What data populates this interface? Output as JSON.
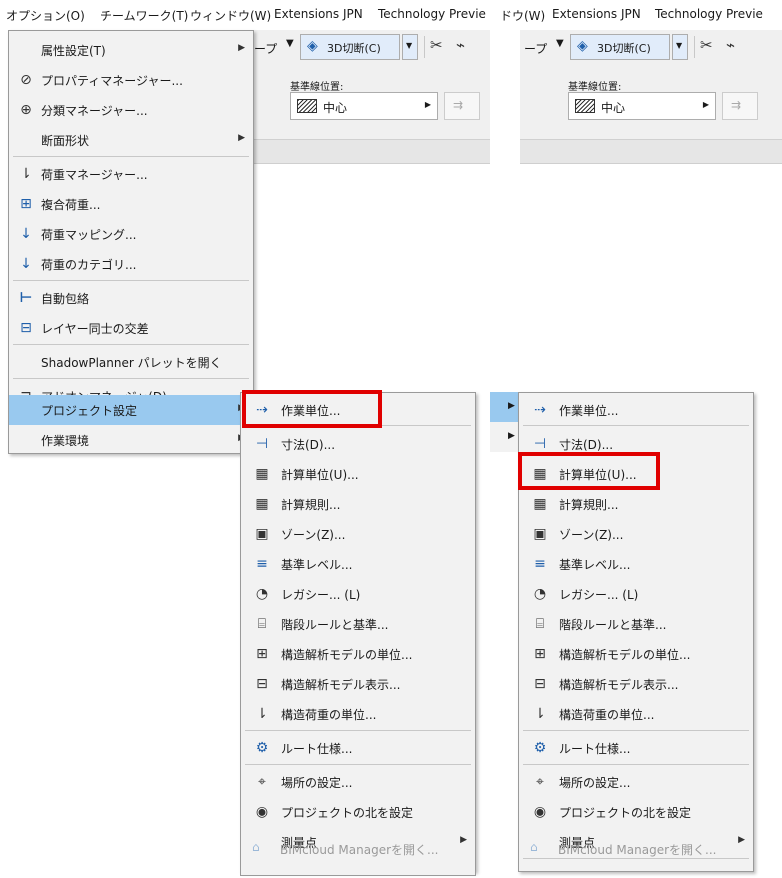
{
  "menubar": {
    "items": [
      "オプション(O)",
      "チームワーク(T)",
      "ウィンドウ(W)",
      "Extensions JPN",
      "Technology Previe"
    ],
    "right_items": [
      "ドウ(W)",
      "Extensions JPN",
      "Technology Previe"
    ]
  },
  "toolbar": {
    "left": {
      "tape_label": "ープ",
      "section_button": "3D切断(C)",
      "baseline_label": "基準線位置:",
      "baseline_value": "中心"
    },
    "right": {
      "tape_label": "ープ",
      "section_button": "3D切断(C)",
      "baseline_label": "基準線位置:",
      "baseline_value": "中心"
    }
  },
  "options_menu": {
    "items": [
      {
        "label": "属性設定(T)",
        "icon": "none",
        "submenu": true
      },
      {
        "label": "プロパティマネージャー...",
        "icon": "tag-icon"
      },
      {
        "label": "分類マネージャー...",
        "icon": "classification-icon"
      },
      {
        "label": "断面形状",
        "icon": "none",
        "submenu": true
      },
      {
        "label": "荷重マネージャー...",
        "icon": "load-manager-icon"
      },
      {
        "label": "複合荷重...",
        "icon": "load-combination-icon"
      },
      {
        "label": "荷重マッピング...",
        "icon": "load-mapping-icon"
      },
      {
        "label": "荷重のカテゴリ...",
        "icon": "load-category-icon"
      },
      {
        "label": "自動包絡",
        "icon": "auto-intersect-icon"
      },
      {
        "label": "レイヤー同士の交差",
        "icon": "layer-intersect-icon"
      },
      {
        "label": "ShadowPlanner パレットを開く",
        "icon": "none"
      },
      {
        "label": "アドオンマネージャ(D)...",
        "icon": "addon-manager-icon"
      },
      {
        "label": "プロジェクト設定",
        "icon": "none",
        "submenu": true
      },
      {
        "label": "作業環境",
        "icon": "none",
        "submenu": true
      }
    ]
  },
  "project_submenu": {
    "items": [
      {
        "label": "作業単位...",
        "icon": "working-units-icon"
      },
      {
        "label": "寸法(D)...",
        "icon": "dimensions-icon"
      },
      {
        "label": "計算単位(U)...",
        "icon": "calculation-units-icon"
      },
      {
        "label": "計算規則...",
        "icon": "calculation-rules-icon"
      },
      {
        "label": "ゾーン(Z)...",
        "icon": "zones-icon"
      },
      {
        "label": "基準レベル...",
        "icon": "reference-levels-icon"
      },
      {
        "label": "レガシー... (L)",
        "icon": "legacy-icon"
      },
      {
        "label": "階段ルールと基準...",
        "icon": "stair-rules-icon"
      },
      {
        "label": "構造解析モデルの単位...",
        "icon": "structural-model-units-icon"
      },
      {
        "label": "構造解析モデル表示...",
        "icon": "structural-model-display-icon"
      },
      {
        "label": "構造荷重の単位...",
        "icon": "structural-load-units-icon"
      },
      {
        "label": "ルート仕様...",
        "icon": "route-specification-icon"
      },
      {
        "label": "場所の設定...",
        "icon": "location-icon"
      },
      {
        "label": "プロジェクトの北を設定",
        "icon": "compass-icon"
      },
      {
        "label": "測量点",
        "icon": "none",
        "submenu": true
      },
      {
        "label": "BIMcloud Managerを開く...",
        "icon": "bimcloud-icon",
        "disabled": true
      }
    ]
  },
  "highlight_color": "#e00000"
}
